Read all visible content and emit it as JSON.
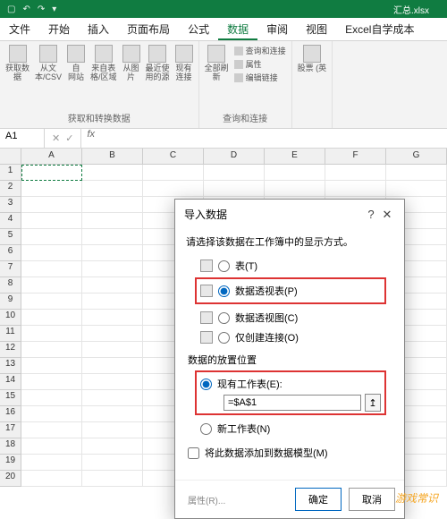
{
  "titlebar": {
    "filename": "汇总.xlsx"
  },
  "tabs": [
    "文件",
    "开始",
    "插入",
    "页面布局",
    "公式",
    "数据",
    "审阅",
    "视图",
    "Excel自学成本"
  ],
  "activeTab": 5,
  "ribbon": {
    "group1": {
      "items": [
        "获取数\n据",
        "从文\n本/CSV",
        "自\n网站",
        "来自表\n格/区域",
        "从图\n片",
        "最近使\n用的源",
        "现有\n连接"
      ],
      "label": "获取和转换数据"
    },
    "group2": {
      "main": "全部刷\n新",
      "mini": [
        "查询和连接",
        "属性",
        "编辑链接"
      ],
      "label": "查询和连接"
    },
    "group3": {
      "main": "股票 (英"
    }
  },
  "namebox": "A1",
  "cols": [
    "A",
    "B",
    "C",
    "D",
    "E",
    "F",
    "G"
  ],
  "rowcount": 20,
  "dialog": {
    "title": "导入数据",
    "instr": "请选择该数据在工作簿中的显示方式。",
    "opt_table": "表(T)",
    "opt_pivot": "数据透视表(P)",
    "opt_chart": "数据透视图(C)",
    "opt_conn": "仅创建连接(O)",
    "section": "数据的放置位置",
    "opt_exist": "现有工作表(E):",
    "location": "=$A$1",
    "opt_new": "新工作表(N)",
    "checkbox": "将此数据添加到数据模型(M)",
    "prop": "属性(R)...",
    "ok": "确定",
    "cancel": "取消"
  },
  "watermark": "游戏常识"
}
